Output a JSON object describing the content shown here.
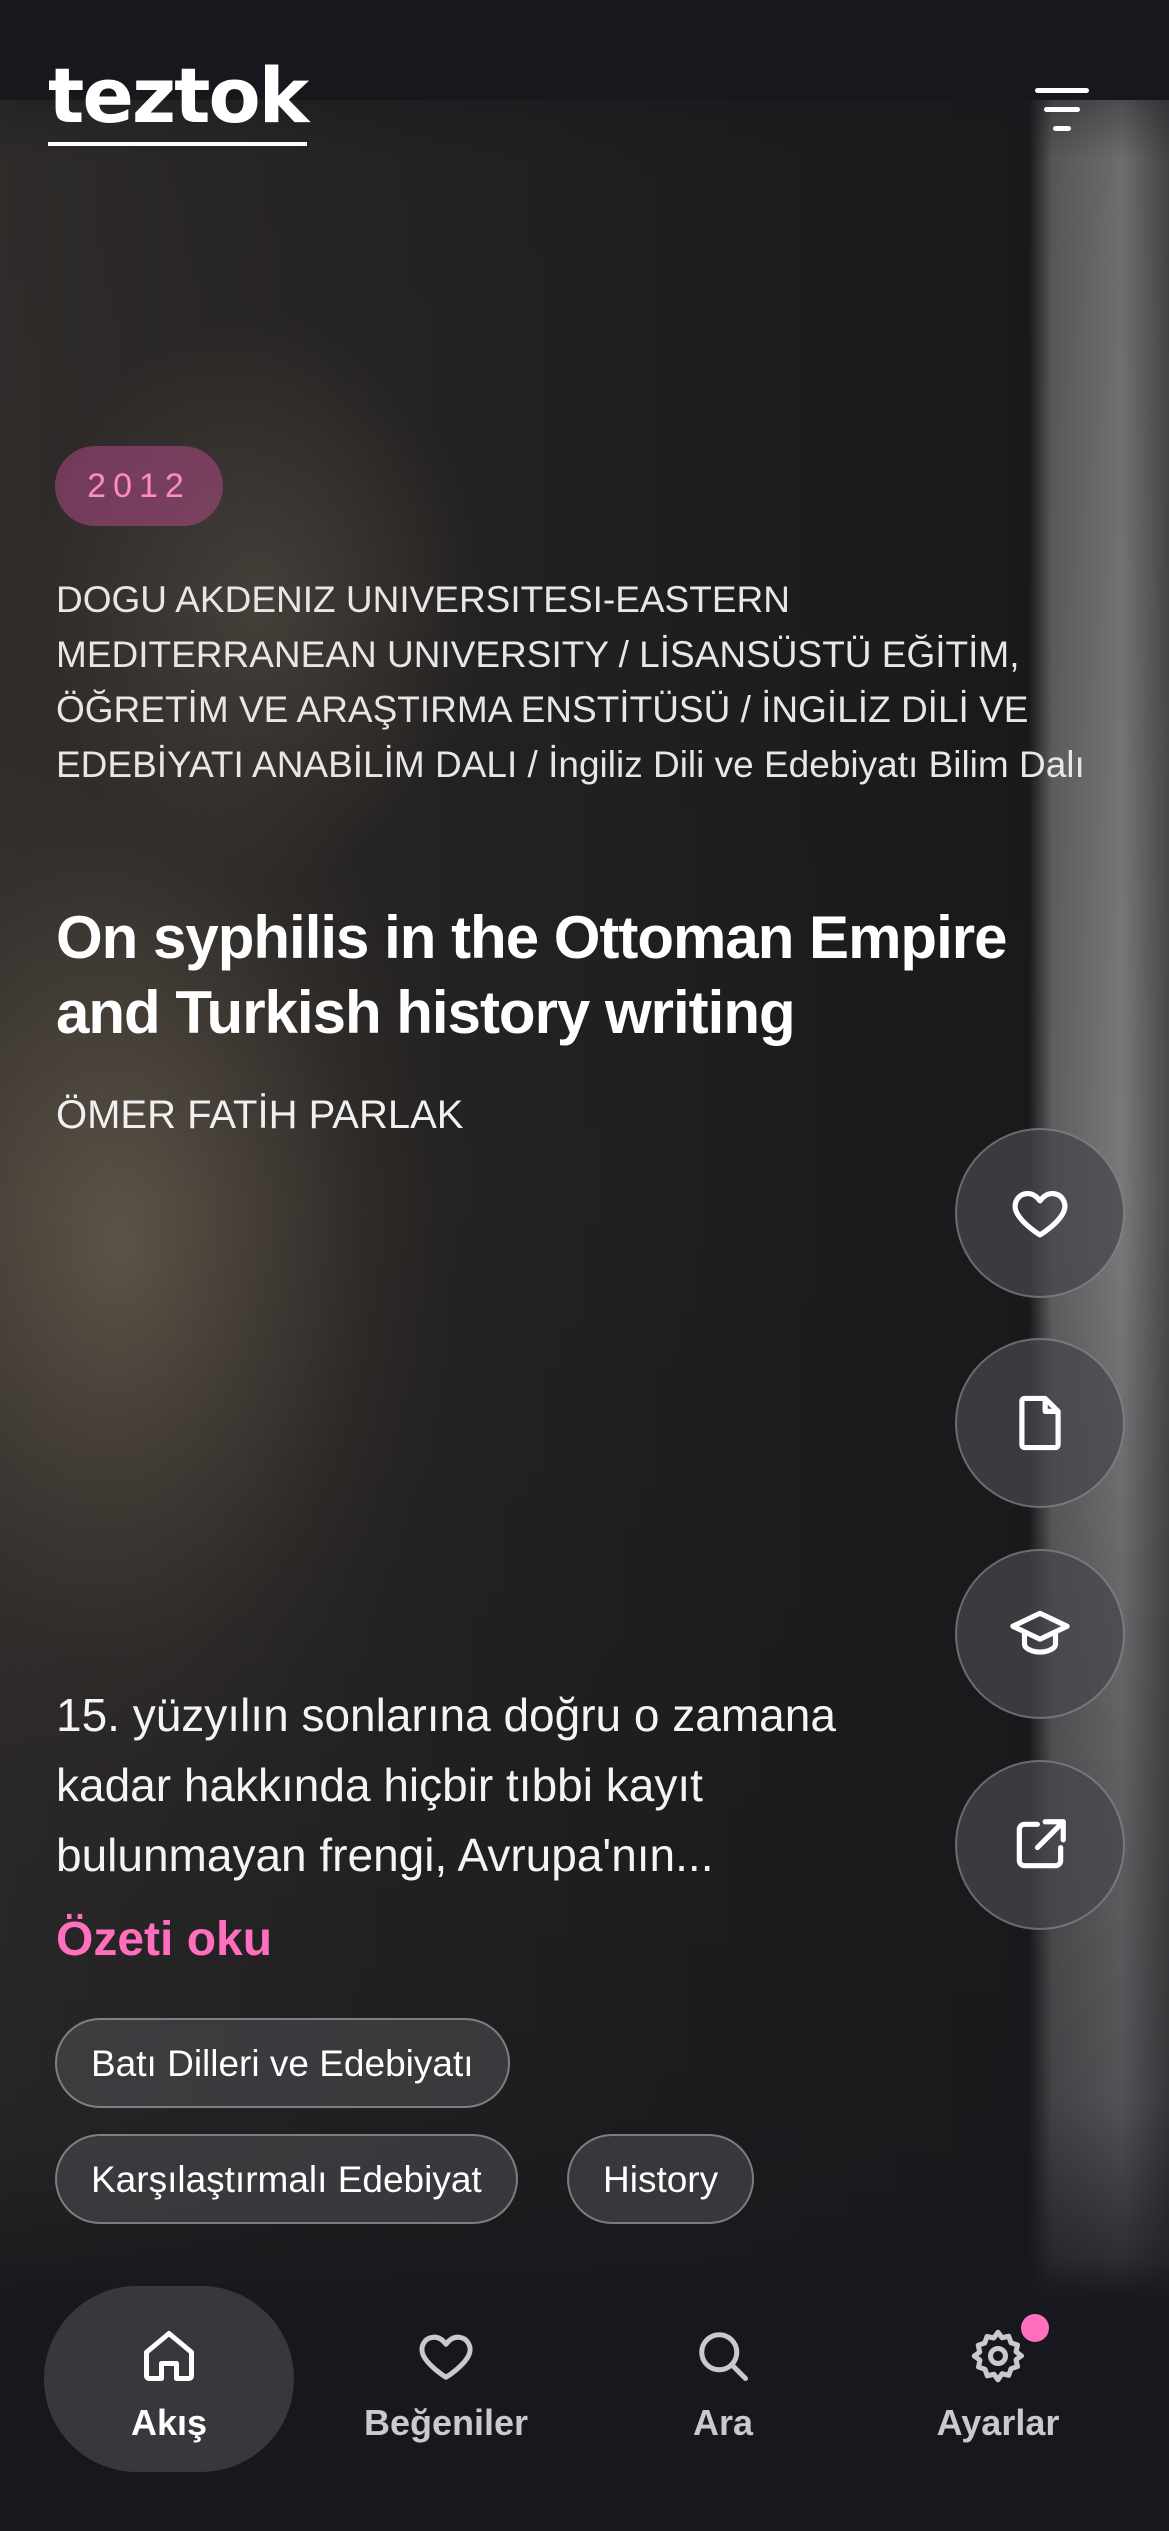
{
  "app": {
    "logo_text": "teztok",
    "accent_color": "#ff6fbd"
  },
  "header": {
    "filter_icon": "filter-lines-icon"
  },
  "thesis": {
    "year": "2012",
    "institution": "DOGU AKDENIZ UNIVERSITESI-EASTERN MEDITERRANEAN UNIVERSITY / LİSANSÜSTÜ EĞİTİM, ÖĞRETİM VE ARAŞTIRMA ENSTİTÜSÜ / İNGİLİZ DİLİ VE EDEBİYATI ANABİLİM DALI / İngiliz Dili ve Edebiyatı Bilim Dalı",
    "title": "On syphilis in the Ottoman Empire and Turkish history writing",
    "author": "ÖMER FATİH PARLAK",
    "summary": "15. yüzyılın sonlarına doğru o zamana kadar hakkında hiçbir tıbbi kayıt bulunmayan frengi, Avrupa'nın...",
    "read_more": "Özeti oku",
    "tags": [
      "Batı Dilleri ve Edebiyatı",
      "Karşılaştırmalı Edebiyat",
      "History"
    ]
  },
  "actions": [
    {
      "icon": "heart-icon"
    },
    {
      "icon": "document-icon"
    },
    {
      "icon": "graduation-cap-icon"
    },
    {
      "icon": "external-link-icon"
    }
  ],
  "nav": {
    "items": [
      {
        "label": "Akış",
        "icon": "home-icon",
        "active": true
      },
      {
        "label": "Beğeniler",
        "icon": "heart-icon",
        "active": false
      },
      {
        "label": "Ara",
        "icon": "search-icon",
        "active": false
      },
      {
        "label": "Ayarlar",
        "icon": "gear-icon",
        "active": false,
        "badge": true
      }
    ]
  }
}
